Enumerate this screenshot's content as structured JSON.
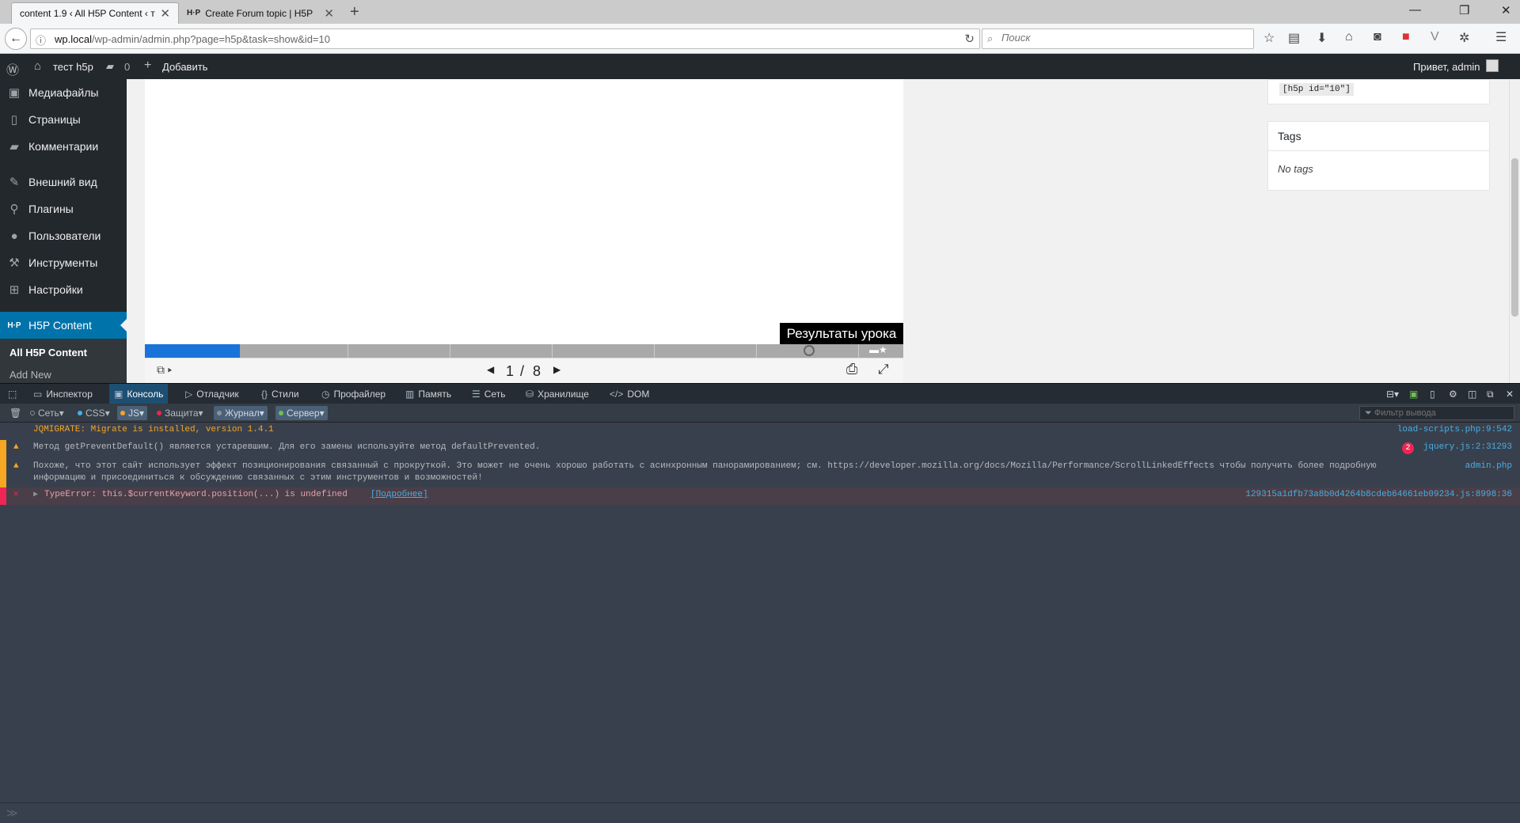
{
  "browser": {
    "tabs": [
      {
        "title": "content 1.9 ‹ All H5P Content ‹ т",
        "active": true
      },
      {
        "title": "Create Forum topic | H5P",
        "active": false
      }
    ],
    "url_host": "wp.local",
    "url_path": "/wp-admin/admin.php?page=h5p&task=show&id=10",
    "search_placeholder": "Поиск"
  },
  "adminbar": {
    "site_name": "тест h5p",
    "comments_count": "0",
    "add_label": "Добавить",
    "greeting": "Привет, admin"
  },
  "sidebar": {
    "items": [
      {
        "label": "Медиафайлы",
        "icon": "media-icon"
      },
      {
        "label": "Страницы",
        "icon": "pages-icon"
      },
      {
        "label": "Комментарии",
        "icon": "comments-icon"
      },
      {
        "label": "Внешний вид",
        "icon": "appearance-icon"
      },
      {
        "label": "Плагины",
        "icon": "plugins-icon"
      },
      {
        "label": "Пользователи",
        "icon": "users-icon"
      },
      {
        "label": "Инструменты",
        "icon": "tools-icon"
      },
      {
        "label": "Настройки",
        "icon": "settings-icon"
      }
    ],
    "current": {
      "label": "H5P Content",
      "icon_text": "H·P"
    },
    "submenu": [
      "All H5P Content",
      "Add New"
    ]
  },
  "h5p": {
    "results_button": "Результаты урока",
    "page_current": "1",
    "page_sep": "/",
    "page_total": "8",
    "progress_fraction": 0.125
  },
  "shortcode": "[h5p id=\"10\"]",
  "tags": {
    "title": "Tags",
    "empty": "No tags"
  },
  "devtools": {
    "tabs": [
      {
        "label": "Инспектор",
        "icon": "inspector-icon",
        "selected": false
      },
      {
        "label": "Консоль",
        "icon": "console-icon",
        "selected": true
      },
      {
        "label": "Отладчик",
        "icon": "debugger-icon",
        "selected": false
      },
      {
        "label": "Стили",
        "icon": "styles-icon",
        "selected": false
      },
      {
        "label": "Профайлер",
        "icon": "profiler-icon",
        "selected": false
      },
      {
        "label": "Память",
        "icon": "memory-icon",
        "selected": false
      },
      {
        "label": "Сеть",
        "icon": "network-icon",
        "selected": false
      },
      {
        "label": "Хранилище",
        "icon": "storage-icon",
        "selected": false
      },
      {
        "label": "DOM",
        "icon": "dom-icon",
        "selected": false
      }
    ],
    "filters": [
      {
        "label": "Сеть",
        "color": "#8a929b",
        "on": false
      },
      {
        "label": "CSS",
        "color": "#46afe3",
        "on": false
      },
      {
        "label": "JS",
        "color": "#f5a623",
        "on": true
      },
      {
        "label": "Защита",
        "color": "#ed2655",
        "on": false
      },
      {
        "label": "Журнал",
        "color": "#8a929b",
        "on": true
      },
      {
        "label": "Сервер",
        "color": "#70bf53",
        "on": true
      }
    ],
    "output_filter_placeholder": "Фильтр вывода",
    "messages": [
      {
        "level": "log",
        "text": "JQMIGRATE: Migrate is installed, version 1.4.1",
        "source": "load-scripts.php:9:542",
        "count": ""
      },
      {
        "level": "warn",
        "text": "Метод getPreventDefault() является устаревшим. Для его замены используйте метод defaultPrevented.",
        "source": "jquery.js:2:31293",
        "count": "2"
      },
      {
        "level": "warn",
        "text": "Похоже, что этот сайт использует эффект позиционирования связанный с прокруткой. Это может не очень хорошо работать с асинхронным панорамированием; см. https://developer.mozilla.org/docs/Mozilla/Performance/ScrollLinkedEffects чтобы получить более подробную",
        "text2": "информацию и присоединиться к обсуждению связанных с этим инструментов и возможностей!",
        "source": "admin.php",
        "count": ""
      },
      {
        "level": "error",
        "text": "TypeError: this.$currentKeyword.position(...) is undefined",
        "link": "[Подробнее]",
        "source": "129315a1dfb73a8b0d4264b8cdeb64661eb09234.js:8998:36",
        "count": ""
      }
    ]
  }
}
